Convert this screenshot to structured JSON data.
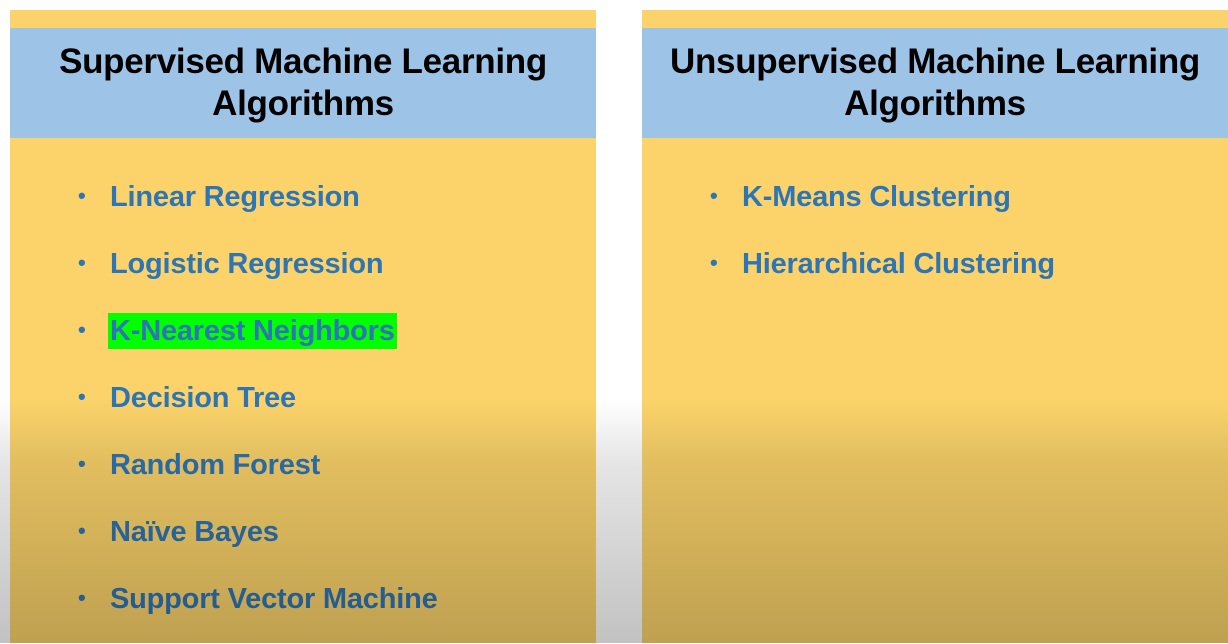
{
  "panels": {
    "supervised": {
      "title": "Supervised Machine Learning Algorithms",
      "items": [
        {
          "label": "Linear Regression",
          "highlighted": false
        },
        {
          "label": "Logistic Regression",
          "highlighted": false
        },
        {
          "label": "K-Nearest Neighbors",
          "highlighted": true
        },
        {
          "label": "Decision Tree",
          "highlighted": false
        },
        {
          "label": "Random Forest",
          "highlighted": false
        },
        {
          "label": "Naïve Bayes",
          "highlighted": false
        },
        {
          "label": "Support Vector Machine",
          "highlighted": false
        }
      ]
    },
    "unsupervised": {
      "title": "Unsupervised Machine Learning Algorithms",
      "items": [
        {
          "label": "K-Means Clustering",
          "highlighted": false
        },
        {
          "label": "Hierarchical  Clustering",
          "highlighted": false
        }
      ]
    }
  },
  "colors": {
    "panel_background": "#fbd36a",
    "header_background": "#9dc3e6",
    "item_text": "#2e75b6",
    "highlight": "#00ff00",
    "title_text": "#000000"
  },
  "bullet_glyph": "•"
}
